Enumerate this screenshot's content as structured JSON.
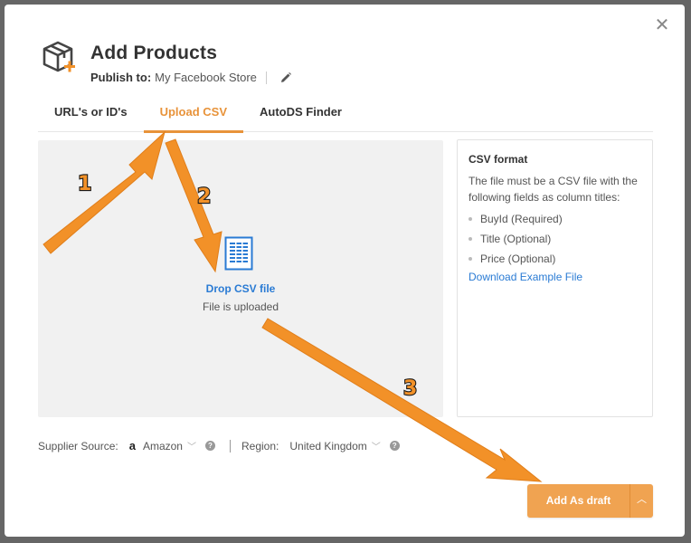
{
  "dialog": {
    "title": "Add Products",
    "publish_label": "Publish to:",
    "store_name": "My Facebook Store",
    "close_icon": "close-icon"
  },
  "tabs": [
    {
      "label": "URL's or ID's",
      "active": false
    },
    {
      "label": "Upload CSV",
      "active": true
    },
    {
      "label": "AutoDS Finder",
      "active": false
    }
  ],
  "dropzone": {
    "title": "Drop CSV file",
    "status": "File is uploaded"
  },
  "csv_format": {
    "title": "CSV format",
    "description": "The file must be a CSV file with the following fields as column titles:",
    "fields": [
      "BuyId (Required)",
      "Title (Optional)",
      "Price (Optional)"
    ],
    "download_link": "Download Example File"
  },
  "footer": {
    "supplier_label": "Supplier Source:",
    "supplier_value": "Amazon",
    "region_label": "Region:",
    "region_value": "United Kingdom",
    "add_button": "Add As draft"
  },
  "annotations": {
    "step1": "1",
    "step2": "2",
    "step3": "3"
  },
  "colors": {
    "accent": "#e8933a",
    "button": "#f0a351",
    "link": "#2a7bd4",
    "arrow": "#f29128"
  }
}
